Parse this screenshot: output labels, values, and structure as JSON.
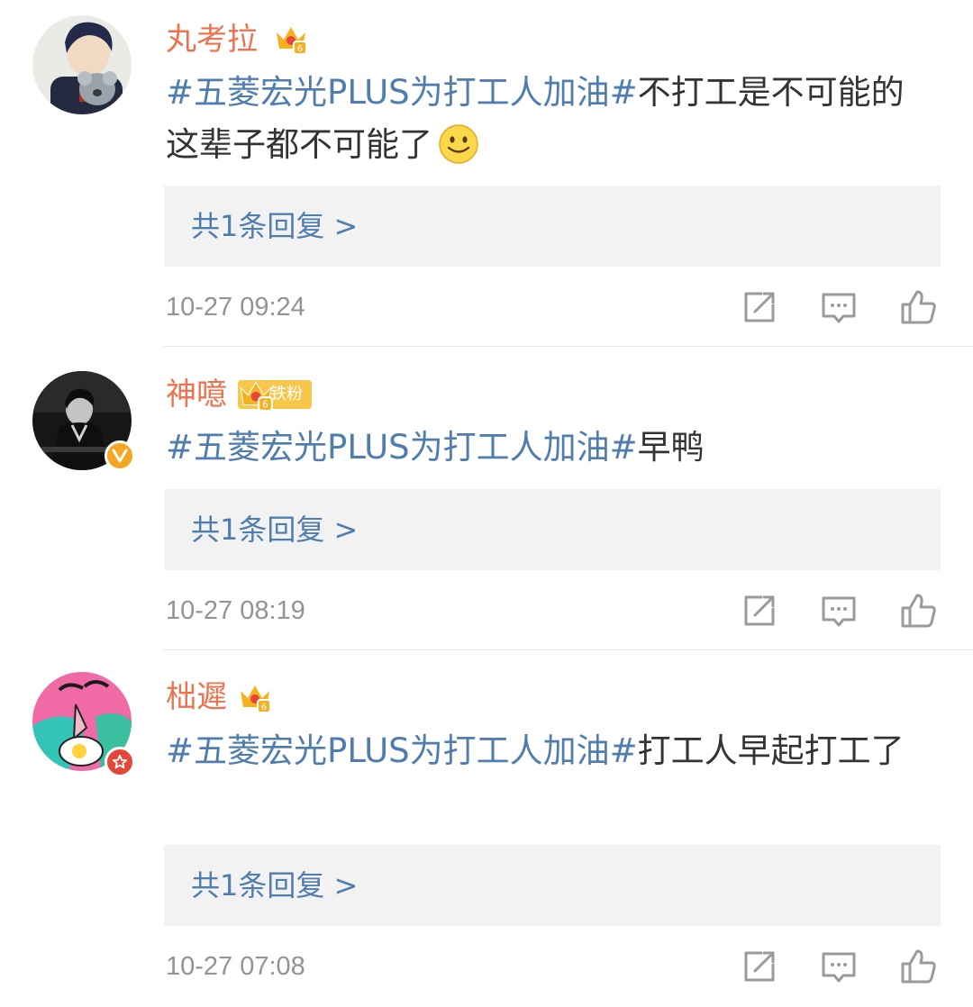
{
  "reply_arrow": ">",
  "comments": [
    {
      "username": "丸考拉",
      "fan_tag": "",
      "topic": "#五菱宏光PLUS为打工人加油#",
      "text": "不打工是不可能的 这辈子都不可能了",
      "emoji": "smile-emoji",
      "reply_label": "共1条回复",
      "time": "10-27 09:24"
    },
    {
      "username": "神噫",
      "fan_tag": "铁粉",
      "topic": "#五菱宏光PLUS为打工人加油#",
      "text": "早鸭",
      "reply_label": "共1条回复",
      "time": "10-27 08:19"
    },
    {
      "username": "柮遲",
      "fan_tag": "",
      "topic": "#五菱宏光PLUS为打工人加油#",
      "text": "打工人早起打工了",
      "reply_label": "共1条回复",
      "time": "10-27 07:08"
    }
  ],
  "colors": {
    "username": "#eb7350",
    "topic": "#507daf",
    "reply_bg": "#f2f2f2",
    "time": "#939393",
    "crown": "#f5b120",
    "verified": "#f5a623",
    "member": "#e5463a"
  },
  "icons": {
    "member_crown": "crown-icon",
    "verified": "verified-v-icon",
    "member_badge": "member-star-icon",
    "repost": "repost-icon",
    "comment": "comment-icon",
    "like": "like-icon"
  }
}
